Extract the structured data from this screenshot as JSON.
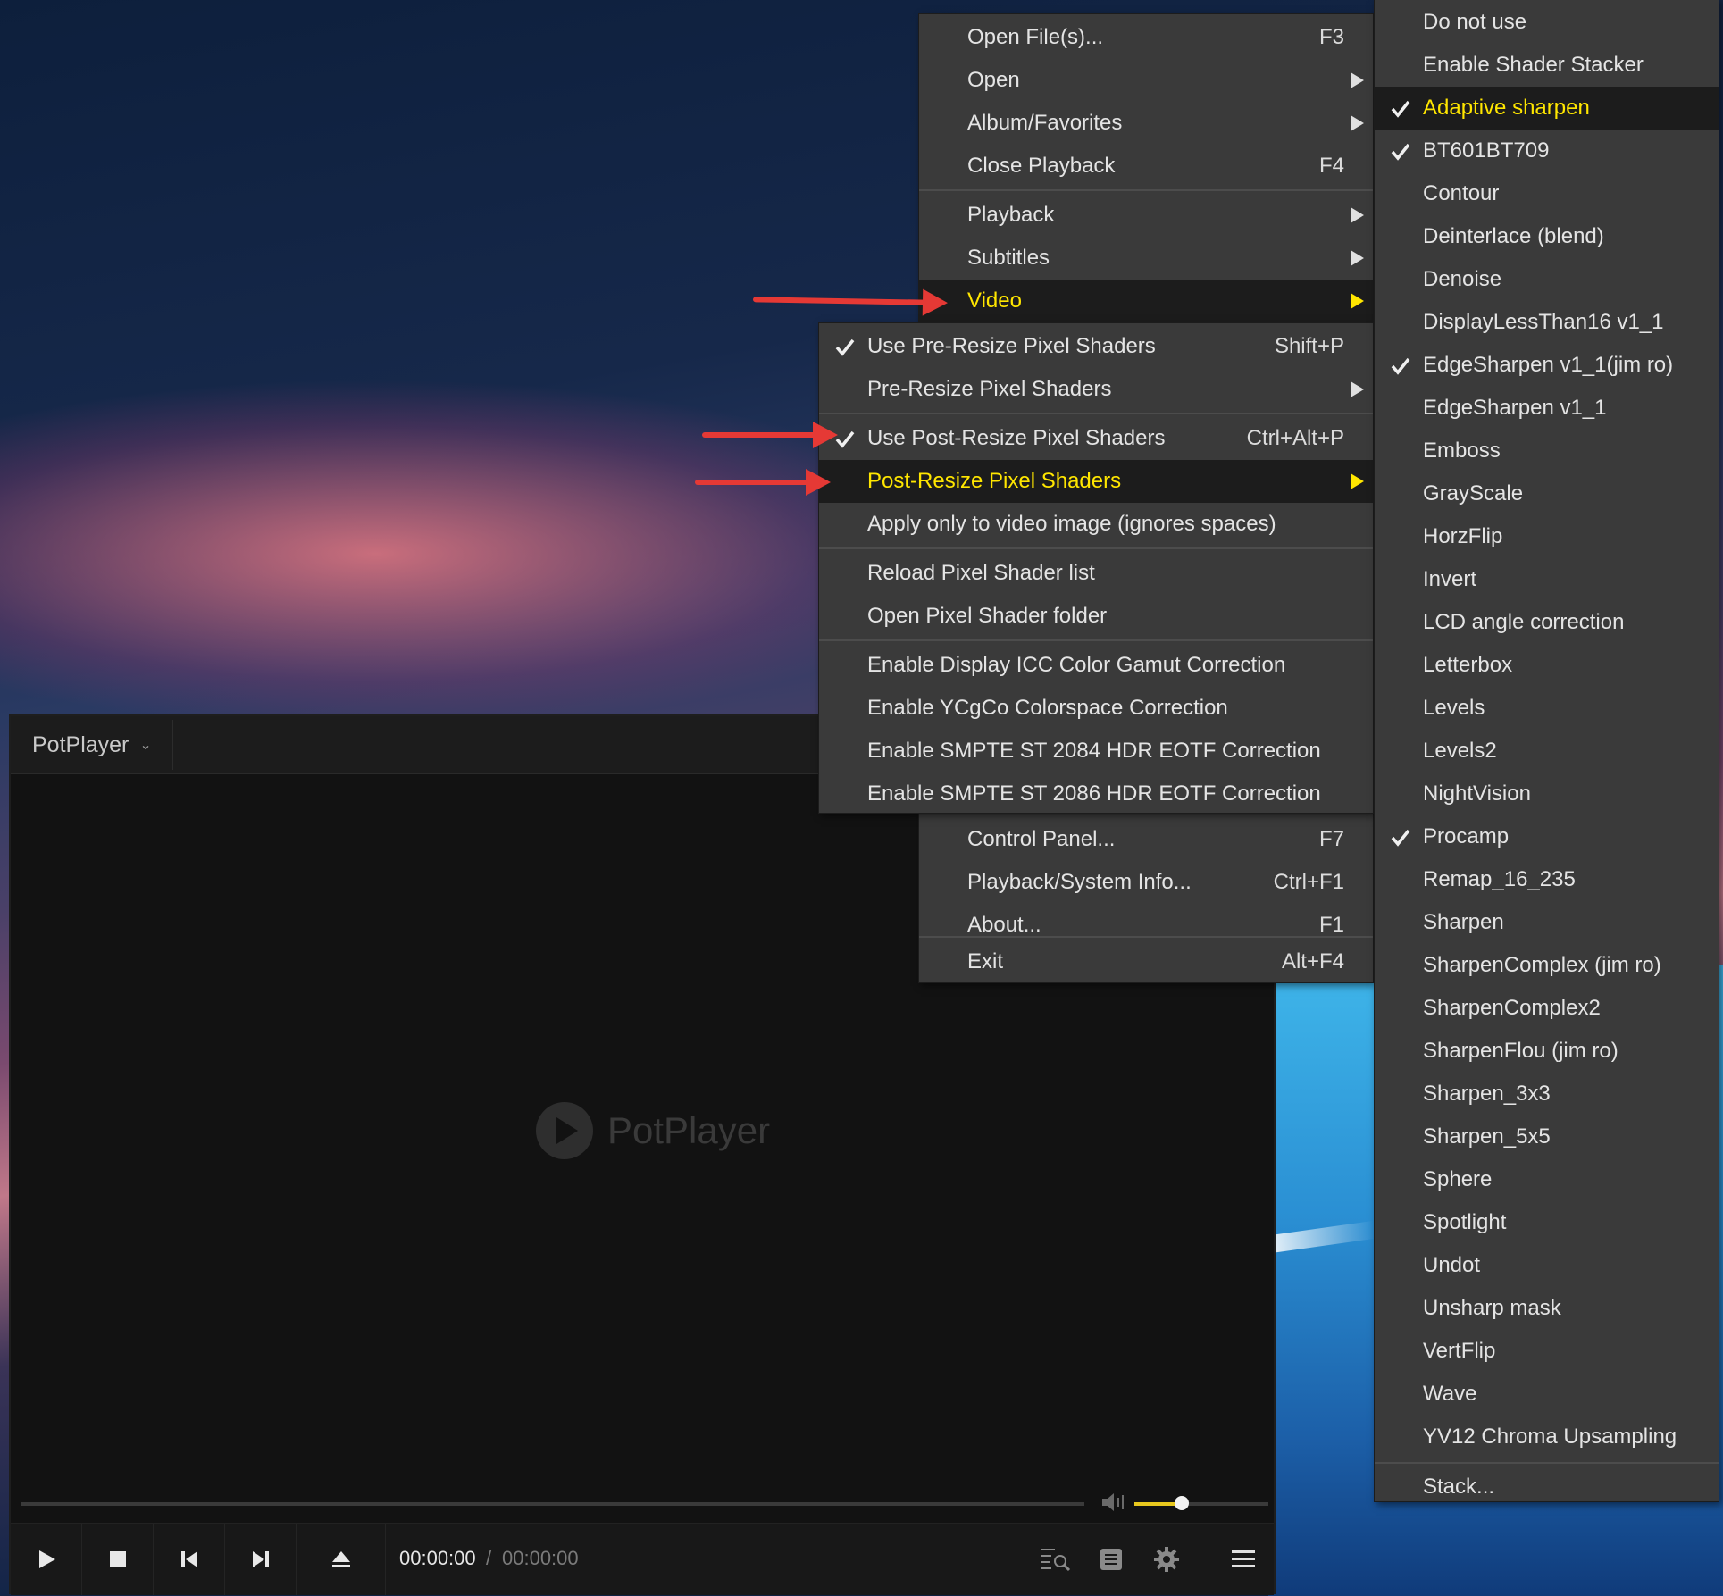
{
  "player": {
    "app_menu_label": "PotPlayer",
    "logo_text": "PotPlayer",
    "time_current": "00:00:00",
    "time_separator": "/",
    "time_total": "00:00:00",
    "volume_level": 0.35
  },
  "main_menu": {
    "items": [
      {
        "label": "Open File(s)...",
        "shortcut": "F3"
      },
      {
        "label": "Open",
        "shortcut": ""
      },
      {
        "label": "Album/Favorites",
        "shortcut": ""
      },
      {
        "label": "Close Playback",
        "shortcut": "F4"
      },
      {
        "label": "Playback",
        "shortcut": ""
      },
      {
        "label": "Subtitles",
        "shortcut": ""
      },
      {
        "label": "Video",
        "shortcut": ""
      },
      {
        "label": "Control Panel...",
        "shortcut": "F7"
      },
      {
        "label": "Playback/System Info...",
        "shortcut": "Ctrl+F1"
      },
      {
        "label": "About...",
        "shortcut": "F1"
      },
      {
        "label": "Exit",
        "shortcut": "Alt+F4"
      }
    ]
  },
  "video_submenu": {
    "items": [
      {
        "label": "Use Pre-Resize Pixel Shaders",
        "shortcut": "Shift+P",
        "checked": true
      },
      {
        "label": "Pre-Resize Pixel Shaders",
        "shortcut": ""
      },
      {
        "label": "Use Post-Resize Pixel Shaders",
        "shortcut": "Ctrl+Alt+P",
        "checked": true
      },
      {
        "label": "Post-Resize Pixel Shaders",
        "shortcut": ""
      },
      {
        "label": "Apply only to video image (ignores spaces)",
        "shortcut": ""
      },
      {
        "label": "Reload Pixel Shader list",
        "shortcut": ""
      },
      {
        "label": "Open Pixel Shader folder",
        "shortcut": ""
      },
      {
        "label": "Enable Display ICC Color Gamut Correction",
        "shortcut": ""
      },
      {
        "label": "Enable YCgCo Colorspace Correction",
        "shortcut": ""
      },
      {
        "label": "Enable SMPTE ST 2084 HDR EOTF Correction",
        "shortcut": ""
      },
      {
        "label": "Enable SMPTE ST 2086 HDR EOTF Correction",
        "shortcut": ""
      }
    ]
  },
  "shader_list": {
    "items": [
      {
        "label": "Do not use",
        "checked": false
      },
      {
        "label": "Enable Shader Stacker",
        "checked": false
      },
      {
        "label": "Adaptive sharpen",
        "checked": true
      },
      {
        "label": "BT601BT709",
        "checked": true
      },
      {
        "label": "Contour",
        "checked": false
      },
      {
        "label": "Deinterlace (blend)",
        "checked": false
      },
      {
        "label": "Denoise",
        "checked": false
      },
      {
        "label": "DisplayLessThan16 v1_1",
        "checked": false
      },
      {
        "label": "EdgeSharpen v1_1(jim ro)",
        "checked": true
      },
      {
        "label": "EdgeSharpen v1_1",
        "checked": false
      },
      {
        "label": "Emboss",
        "checked": false
      },
      {
        "label": "GrayScale",
        "checked": false
      },
      {
        "label": "HorzFlip",
        "checked": false
      },
      {
        "label": "Invert",
        "checked": false
      },
      {
        "label": "LCD angle correction",
        "checked": false
      },
      {
        "label": "Letterbox",
        "checked": false
      },
      {
        "label": "Levels",
        "checked": false
      },
      {
        "label": "Levels2",
        "checked": false
      },
      {
        "label": "NightVision",
        "checked": false
      },
      {
        "label": "Procamp",
        "checked": true
      },
      {
        "label": "Remap_16_235",
        "checked": false
      },
      {
        "label": "Sharpen",
        "checked": false
      },
      {
        "label": "SharpenComplex (jim ro)",
        "checked": false
      },
      {
        "label": "SharpenComplex2",
        "checked": false
      },
      {
        "label": "SharpenFlou (jim ro)",
        "checked": false
      },
      {
        "label": "Sharpen_3x3",
        "checked": false
      },
      {
        "label": "Sharpen_5x5",
        "checked": false
      },
      {
        "label": "Sphere",
        "checked": false
      },
      {
        "label": "Spotlight",
        "checked": false
      },
      {
        "label": "Undot",
        "checked": false
      },
      {
        "label": "Unsharp mask",
        "checked": false
      },
      {
        "label": "VertFlip",
        "checked": false
      },
      {
        "label": "Wave",
        "checked": false
      },
      {
        "label": "YV12 Chroma Upsampling",
        "checked": false
      },
      {
        "label": "Stack...",
        "checked": false
      }
    ]
  },
  "colors": {
    "highlight_text": "#ffe600",
    "menu_bg": "#3a3a3a",
    "annotation_arrow": "#e53935",
    "volume_fill": "#e8c81e"
  }
}
